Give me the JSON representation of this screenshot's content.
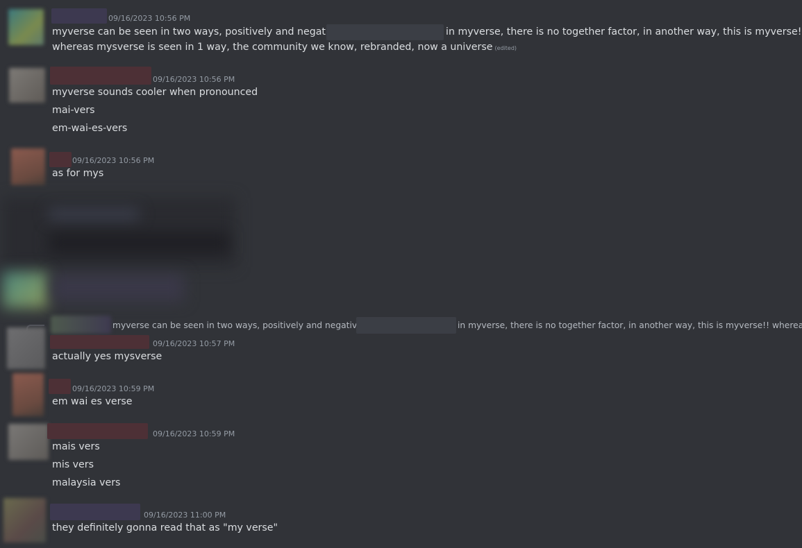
{
  "messages": [
    {
      "timestamp": "09/16/2023 10:56 PM",
      "lines": [
        {
          "before": "myverse can be seen in two ways, positively and negatively",
          "after": "in myverse, there is no together factor, in another way, this is myverse!!"
        },
        {
          "text": "whereas mysverse is seen in 1 way, the community we know, rebranded, now a universe",
          "edited": "(edited)"
        }
      ]
    },
    {
      "timestamp": "09/16/2023 10:56 PM",
      "lines": [
        "myverse sounds cooler when pronounced",
        "mai-vers",
        "em-wai-es-vers"
      ]
    },
    {
      "timestamp": "09/16/2023 10:56 PM",
      "lines": [
        "as for mys"
      ]
    },
    {
      "reply_preview": {
        "before": "myverse can be seen in two ways, positively and negatively,",
        "after": "in myverse, there is no together factor, in another way, this is myverse!! whereas"
      },
      "timestamp": "09/16/2023 10:57 PM",
      "lines": [
        "actually yes mysverse"
      ]
    },
    {
      "timestamp": "09/16/2023 10:59 PM",
      "lines": [
        "em wai es verse"
      ]
    },
    {
      "timestamp": "09/16/2023 10:59 PM",
      "lines": [
        "mais vers",
        "mis vers",
        "malaysia vers"
      ]
    },
    {
      "timestamp": "09/16/2023 11:00 PM",
      "lines": [
        "they definitely gonna read that as \"my verse\""
      ]
    }
  ],
  "colors": {
    "background": "#313338",
    "text": "#dbdee1",
    "muted": "#949ba4"
  }
}
